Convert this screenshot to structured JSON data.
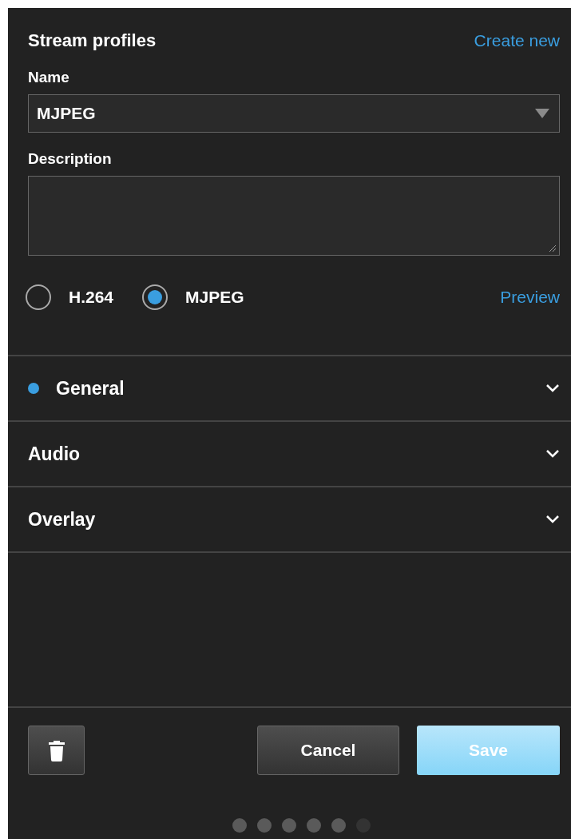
{
  "panel": {
    "title": "Stream profiles",
    "create_link": "Create new"
  },
  "name_field": {
    "label": "Name",
    "value": "MJPEG"
  },
  "description_field": {
    "label": "Description"
  },
  "formats": [
    {
      "label": "H.264",
      "selected": false
    },
    {
      "label": "MJPEG",
      "selected": true
    }
  ],
  "preview_link": "Preview",
  "sections": [
    {
      "title": "General",
      "modified": true,
      "expanded": false
    },
    {
      "title": "Audio",
      "modified": false,
      "expanded": false
    },
    {
      "title": "Overlay",
      "modified": false,
      "expanded": false
    }
  ],
  "buttons": {
    "cancel": "Cancel",
    "save": {
      "label": "Save",
      "disabled": true
    }
  },
  "progress_dots": [
    {
      "on": true
    },
    {
      "on": true
    },
    {
      "on": true
    },
    {
      "on": true
    },
    {
      "on": true
    },
    {
      "on": false
    }
  ]
}
